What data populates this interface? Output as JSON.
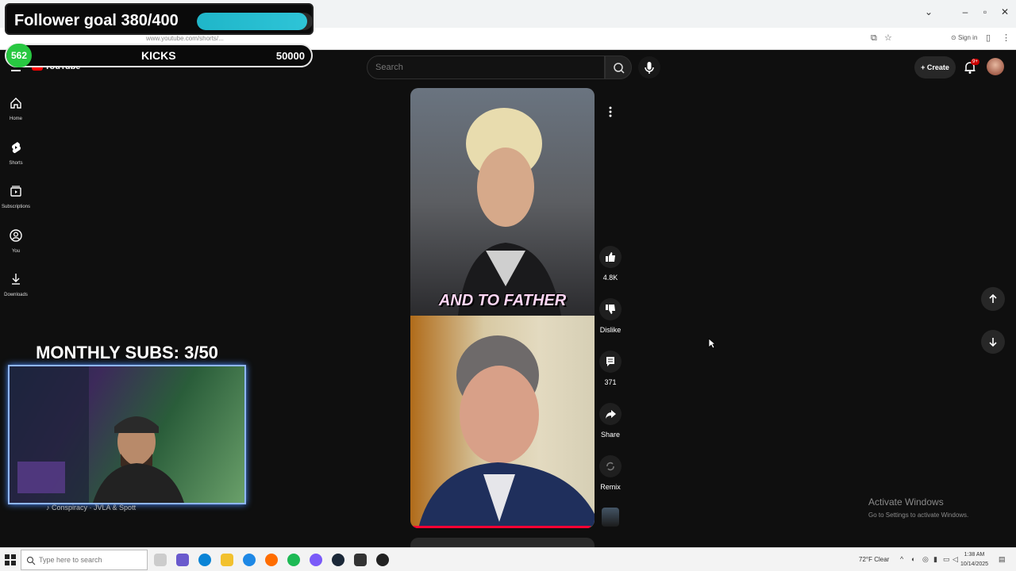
{
  "browser": {
    "url": "www.youtube.com/shorts/...",
    "signin_label": "Sign in"
  },
  "overlay": {
    "follower_goal_label": "Follower goal 380/400",
    "follower_progress": 0.95,
    "kicks_count": "562",
    "kicks_label": "KICKS",
    "kicks_goal": "50000",
    "monthly_subs": "MONTHLY SUBS: 3/50",
    "now_playing": "Conspiracy · JVLA & Spott"
  },
  "youtube": {
    "logo": "YouTube",
    "search_placeholder": "Search",
    "create_label": "Create",
    "notifications_badge": "9+"
  },
  "sidebar": {
    "items": [
      {
        "label": "Home",
        "icon": "home-icon"
      },
      {
        "label": "Shorts",
        "icon": "shorts-icon"
      },
      {
        "label": "Subscriptions",
        "icon": "subscriptions-icon"
      },
      {
        "label": "You",
        "icon": "you-icon"
      },
      {
        "label": "Downloads",
        "icon": "downloads-icon"
      }
    ]
  },
  "short": {
    "caption": "AND TO FATHER",
    "progress": 0.98,
    "actions": {
      "like_count": "4.8K",
      "dislike_label": "Dislike",
      "comment_count": "371",
      "share_label": "Share",
      "remix_label": "Remix"
    }
  },
  "windows": {
    "activate_title": "Activate Windows",
    "activate_sub": "Go to Settings to activate Windows.",
    "taskbar_search": "Type here to search",
    "weather": "72°F  Clear",
    "time": "1:38 AM",
    "date": "10/14/2025"
  },
  "colors": {
    "accent_red": "#ff0000",
    "progress_teal": "#1fb6c9",
    "kicks_green": "#28c841"
  }
}
